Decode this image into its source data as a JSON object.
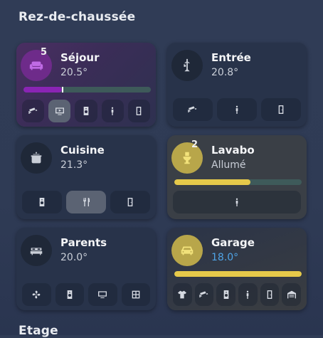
{
  "sections": {
    "ground_floor": "Rez-de-chaussée",
    "upper_floor": "Etage"
  },
  "rooms": {
    "sejour": {
      "name": "Séjour",
      "value": "20.5°",
      "badge": "5",
      "level": 0.26
    },
    "entree": {
      "name": "Entrée",
      "value": "20.8°"
    },
    "cuisine": {
      "name": "Cuisine",
      "value": "21.3°"
    },
    "lavabo": {
      "name": "Lavabo",
      "value": "Allumé",
      "badge": "2",
      "level": 0.6
    },
    "parents": {
      "name": "Parents",
      "value": "20.0°"
    },
    "garage": {
      "name": "Garage",
      "value": "18.0°",
      "level": 1.0
    }
  },
  "colors": {
    "purple": "#8a24b4",
    "yellow": "#e6c94a",
    "blue_value": "#4fa3e6",
    "track": "#3e5a5a"
  }
}
